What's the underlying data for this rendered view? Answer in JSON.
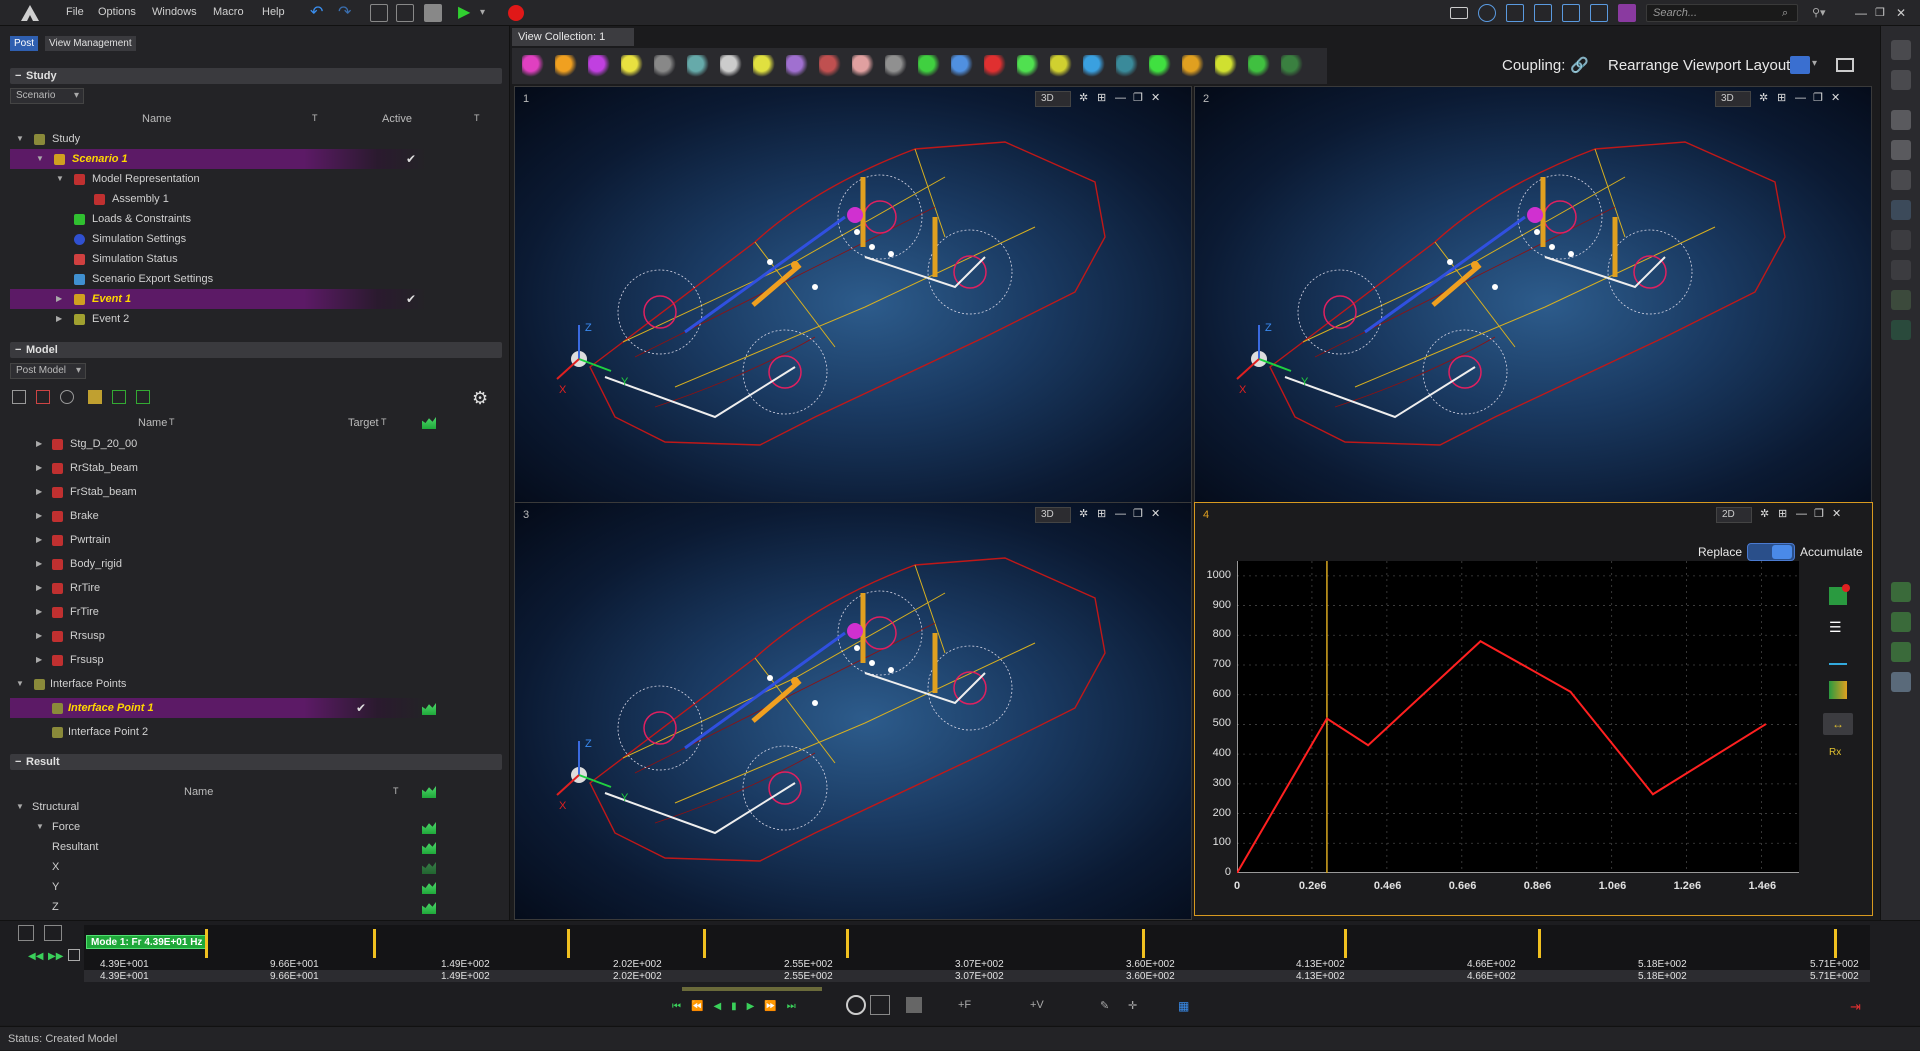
{
  "menu": {
    "file": "File",
    "options": "Options",
    "windows": "Windows",
    "macro": "Macro",
    "help": "Help"
  },
  "search": {
    "placeholder": "Search..."
  },
  "left_tabs": {
    "post": "Post",
    "view_management": "View Management"
  },
  "study": {
    "header": "Study",
    "combo": "Scenario",
    "col_name": "Name",
    "col_active": "Active",
    "rows": [
      {
        "label": "Study"
      },
      {
        "label": "Scenario 1"
      },
      {
        "label": "Model Representation"
      },
      {
        "label": "Assembly 1"
      },
      {
        "label": "Loads & Constraints"
      },
      {
        "label": "Simulation Settings"
      },
      {
        "label": "Simulation Status"
      },
      {
        "label": "Scenario Export Settings"
      },
      {
        "label": "Event 1"
      },
      {
        "label": "Event 2"
      }
    ]
  },
  "model": {
    "header": "Model",
    "combo": "Post Model",
    "col_name": "Name",
    "col_target": "Target",
    "rows": [
      {
        "label": "Stg_D_20_00"
      },
      {
        "label": "RrStab_beam"
      },
      {
        "label": "FrStab_beam"
      },
      {
        "label": "Brake"
      },
      {
        "label": "Pwrtrain"
      },
      {
        "label": "Body_rigid"
      },
      {
        "label": "RrTire"
      },
      {
        "label": "FrTire"
      },
      {
        "label": "Rrsusp"
      },
      {
        "label": "Frsusp"
      },
      {
        "label": "Interface Points"
      },
      {
        "label": "Interface Point 1"
      },
      {
        "label": "Interface Point 2"
      }
    ]
  },
  "result": {
    "header": "Result",
    "col_name": "Name",
    "rows": [
      {
        "label": "Structural"
      },
      {
        "label": "Force"
      },
      {
        "label": "Resultant"
      },
      {
        "label": "X"
      },
      {
        "label": "Y"
      },
      {
        "label": "Z"
      }
    ]
  },
  "view_collection": "View Collection: 1",
  "coupling_label": "Coupling:",
  "rearrange_label": "Rearrange Viewport Layout:",
  "viewports": [
    {
      "num": "1",
      "mode": "3D"
    },
    {
      "num": "2",
      "mode": "3D"
    },
    {
      "num": "3",
      "mode": "3D"
    },
    {
      "num": "4",
      "mode": "2D"
    }
  ],
  "plot_toggle": {
    "left": "Replace",
    "right": "Accumulate"
  },
  "axis_labels": {
    "x": "X",
    "y": "Y",
    "z": "Z"
  },
  "chart_data": {
    "type": "line",
    "title": "",
    "xlabel": "",
    "ylabel": "",
    "xlim": [
      0,
      1500000
    ],
    "ylim": [
      0,
      1050
    ],
    "x_ticks": [
      "0",
      "0.2e6",
      "0.4e6",
      "0.6e6",
      "0.8e6",
      "1.0e6",
      "1.2e6",
      "1.4e6"
    ],
    "x_tick_values": [
      0,
      200000,
      400000,
      600000,
      800000,
      1000000,
      1200000,
      1400000
    ],
    "y_ticks": [
      "0",
      "100",
      "200",
      "300",
      "400",
      "500",
      "600",
      "700",
      "800",
      "900",
      "1000"
    ],
    "y_tick_values": [
      0,
      100,
      200,
      300,
      400,
      500,
      600,
      700,
      800,
      900,
      1000
    ],
    "series": [
      {
        "color": "#ff2020",
        "x": [
          0,
          240000,
          350000,
          650000,
          890000,
          1110000,
          1410000
        ],
        "y": [
          0,
          520,
          430,
          780,
          610,
          265,
          500
        ]
      }
    ],
    "cursor_x": 240000,
    "grid": true
  },
  "timeline": {
    "mode_badge": "Mode 1: Fr 4.39E+01 Hz",
    "labels": [
      "4.39E+001",
      "9.66E+001",
      "1.49E+002",
      "2.02E+002",
      "2.55E+002",
      "3.07E+002",
      "3.60E+002",
      "4.13E+002",
      "4.66E+002",
      "5.18E+002",
      "5.71E+002"
    ]
  },
  "status": {
    "label": "Status:",
    "value": "Created Model"
  }
}
